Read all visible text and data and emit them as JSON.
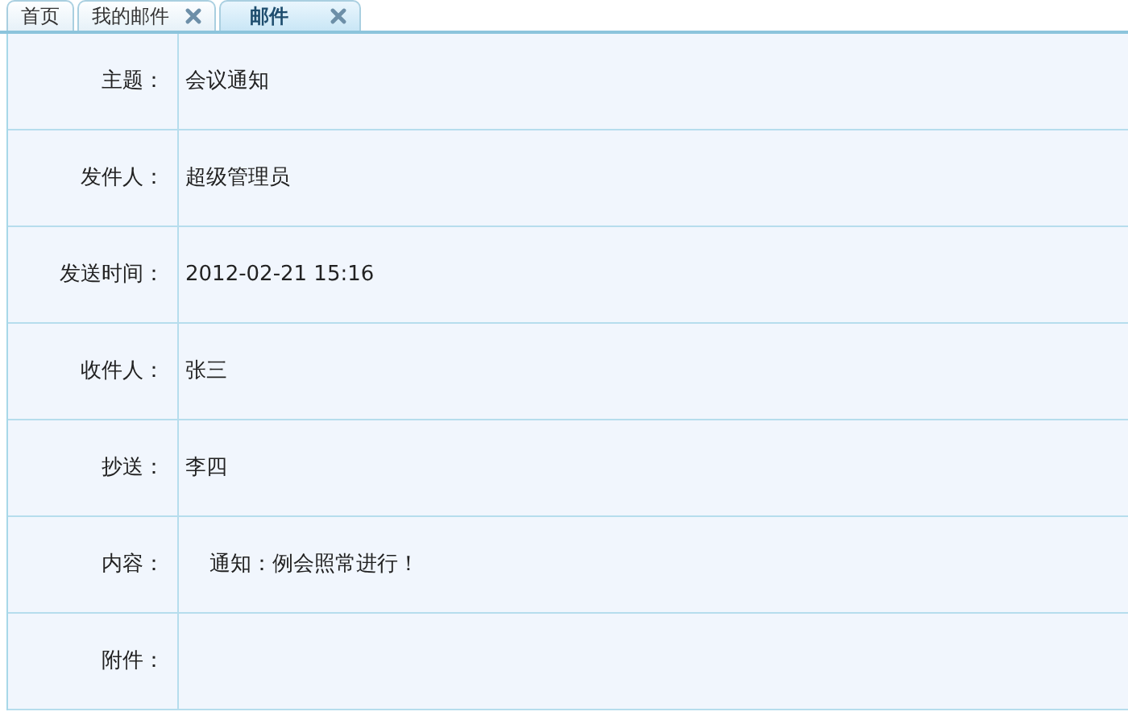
{
  "tabs": [
    {
      "label": "首页",
      "selected": false,
      "closable": false
    },
    {
      "label": "我的邮件",
      "selected": false,
      "closable": true
    },
    {
      "label": "邮件",
      "selected": true,
      "closable": true
    }
  ],
  "fields": [
    {
      "label": "主题：",
      "value": "会议通知",
      "kind": "text"
    },
    {
      "label": "发件人：",
      "value": "超级管理员",
      "kind": "text"
    },
    {
      "label": "发送时间：",
      "value": "2012-02-21 15:16",
      "kind": "text"
    },
    {
      "label": "收件人：",
      "value": "张三",
      "kind": "text"
    },
    {
      "label": "抄送：",
      "value": "李四",
      "kind": "text"
    },
    {
      "label": "内容：",
      "value": "通知：例会照常进行！",
      "kind": "body"
    },
    {
      "label": "附件：",
      "kind": "text"
    }
  ]
}
